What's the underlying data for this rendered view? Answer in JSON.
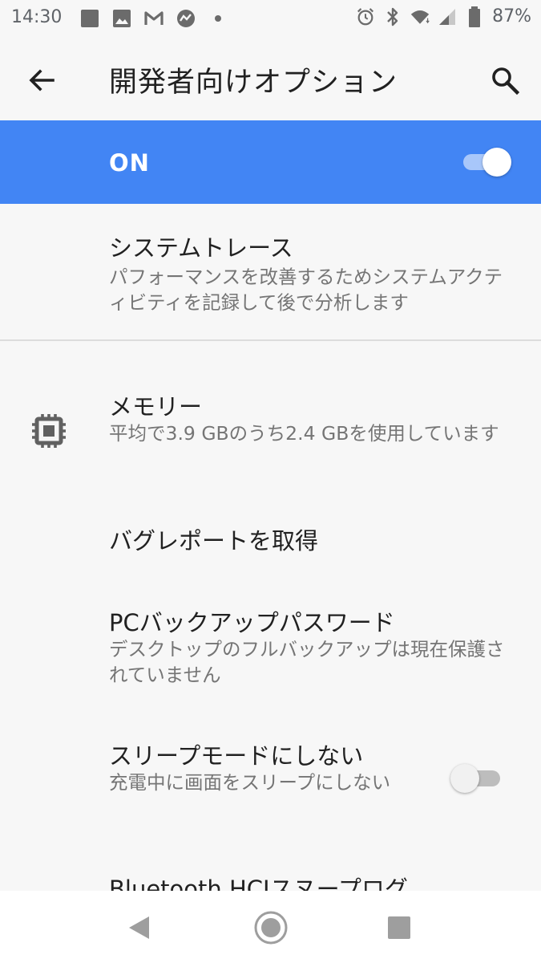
{
  "status_bar": {
    "time": "14:30",
    "battery": "87%",
    "left_icons": [
      "square-notification-icon",
      "image-icon",
      "gmail-icon",
      "chart-app-icon",
      "dot-icon"
    ],
    "right_icons": [
      "alarm-icon",
      "bluetooth-icon",
      "wifi-icon",
      "signal-icon",
      "battery-icon"
    ]
  },
  "app_bar": {
    "title": "開発者向けオプション",
    "back_icon": "arrow-back-icon",
    "search_icon": "search-icon"
  },
  "master_switch": {
    "label": "ON",
    "checked": true,
    "accent_color": "#4285f4"
  },
  "settings": [
    {
      "title": "システムトレース",
      "summary": "パフォーマンスを改善するためシステムアクティビティを記録して後で分析します"
    },
    {
      "title": "メモリー",
      "summary": "平均で3.9 GBのうち2.4 GBを使用しています",
      "icon": "memory-chip-icon"
    },
    {
      "title": "バグレポートを取得"
    },
    {
      "title": "PCバックアップパスワード",
      "summary": "デスクトップのフルバックアップは現在保護されていません"
    },
    {
      "title": "スリープモードにしない",
      "summary": "充電中に画面をスリープにしない",
      "toggle_checked": false
    },
    {
      "title": "Bluetooth HCIスヌープログ"
    }
  ],
  "nav_bar": {
    "icons": [
      "nav-back-icon",
      "nav-home-icon",
      "nav-recents-icon"
    ]
  }
}
